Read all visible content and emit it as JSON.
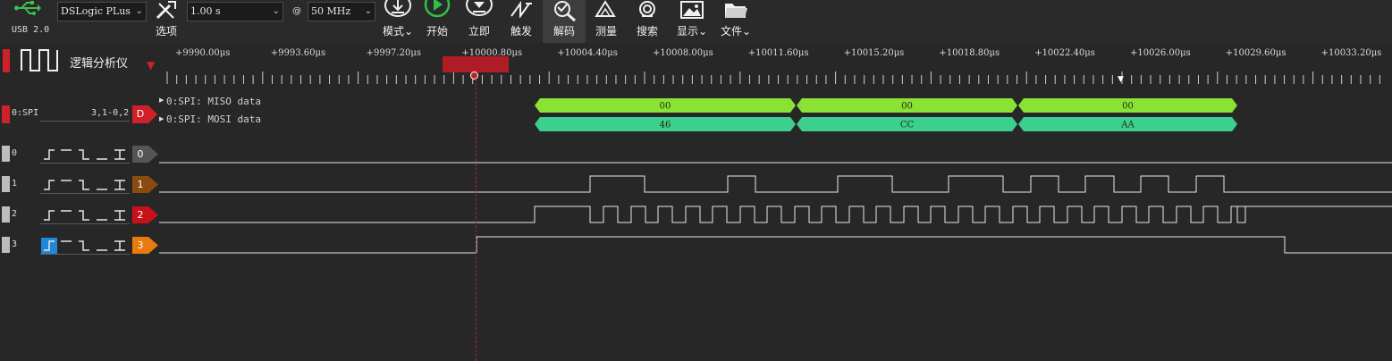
{
  "toolbar": {
    "usb_label": "USB 2.0",
    "device": "DSLogic PLus",
    "options_label": "选项",
    "duration": "1.00 s",
    "at_symbol": "@",
    "rate": "50 MHz",
    "mode_label": "模式",
    "start_label": "开始",
    "instant_label": "立即",
    "trigger_label": "触发",
    "decode_label": "解码",
    "measure_label": "测量",
    "search_label": "搜索",
    "display_label": "显示",
    "file_label": "文件"
  },
  "panel": {
    "title": "逻辑分析仪"
  },
  "ruler": {
    "labels": [
      "+9990.00μs",
      "+9993.60μs",
      "+9997.20μs",
      "+10000.80μs",
      "+10004.40μs",
      "+10008.00μs",
      "+10011.60μs",
      "+10015.20μs",
      "+10018.80μs",
      "+10022.40μs",
      "+10026.00μs",
      "+10029.60μs",
      "+10033.20μs"
    ]
  },
  "decoder": {
    "name": "0:SPI",
    "channels": "3,1-0,2",
    "badge": "D",
    "miso_label": "0:SPI: MISO data",
    "mosi_label": "0:SPI: MOSI data",
    "miso_values": [
      "00",
      "00",
      "00"
    ],
    "mosi_values": [
      "46",
      "CC",
      "AA"
    ]
  },
  "channels": [
    {
      "id": "0",
      "badge": "0",
      "color": "#555555"
    },
    {
      "id": "1",
      "badge": "1",
      "color": "#8a4b10"
    },
    {
      "id": "2",
      "badge": "2",
      "color": "#c8101a"
    },
    {
      "id": "3",
      "badge": "3",
      "color": "#e87a0e"
    }
  ],
  "colors": {
    "miso": "#8ae234",
    "mosi": "#3dcf8e",
    "cursor": "#c0202a",
    "accent": "#d0202a"
  }
}
